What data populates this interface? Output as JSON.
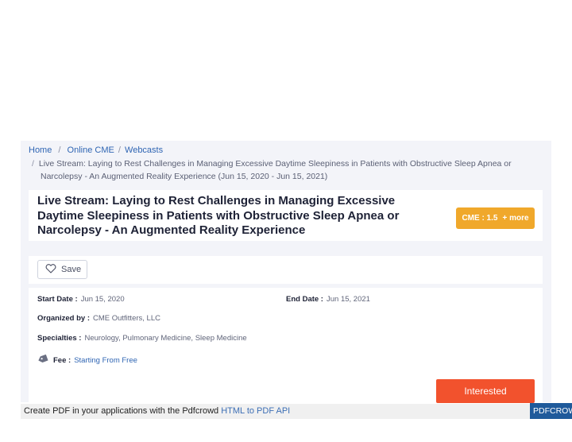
{
  "breadcrumb": {
    "home": "Home",
    "sep1": "/",
    "online_cme": "Online CME",
    "sep2": "/",
    "webcasts": "Webcasts",
    "sep3": "/",
    "current_line1": "Live Stream: Laying to Rest Challenges in Managing Excessive Daytime Sleepiness in Patients with Obstructive Sleep Apnea or",
    "current_line2": "Narcolepsy - An Augmented Reality Experience (Jun 15, 2020 - Jun 15, 2021)"
  },
  "event": {
    "title": "Live Stream: Laying to Rest Challenges in Managing Excessive Daytime Sleepiness in Patients with Obstructive Sleep Apnea or Narcolepsy - An Augmented Reality Experience",
    "cme_label": "CME : 1.5",
    "more_label": "+ more"
  },
  "actions": {
    "save_label": "Save",
    "interested_label": "Interested"
  },
  "details": {
    "start_label": "Start Date :",
    "start_value": "Jun 15, 2020",
    "end_label": "End Date :",
    "end_value": "Jun 15, 2021",
    "organizer_label": "Organized by :",
    "organizer_value": "CME Outfitters, LLC",
    "specialties_label": "Specialties :",
    "specialties": [
      "Neurology",
      "Pulmonary Medicine",
      "Sleep Medicine"
    ],
    "specialty_sep": ",",
    "fee_label": "Fee :",
    "fee_value": "Starting From Free"
  },
  "footer": {
    "text": "Create PDF in your applications with the Pdfcrowd",
    "link": "HTML to PDF API",
    "tag": "PDFCROWD"
  },
  "icons": {
    "save": "heart-icon",
    "fee": "price-tag-icon"
  },
  "colors": {
    "accent_orange": "#f2522d",
    "cme_badge": "#f0a82b",
    "link_blue": "#2f65b3"
  }
}
